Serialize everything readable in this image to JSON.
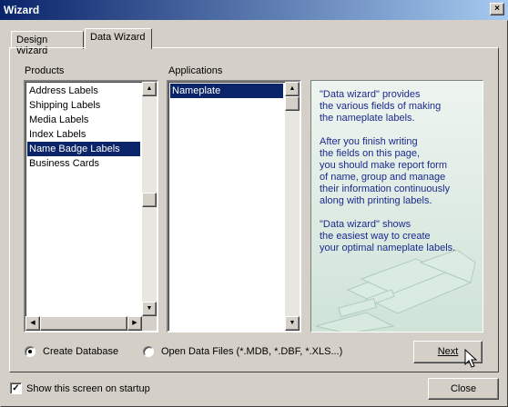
{
  "window": {
    "title": "Wizard",
    "close_glyph": "×"
  },
  "tabs": [
    {
      "label": "Design Wizard"
    },
    {
      "label": "Data Wizard"
    }
  ],
  "products": {
    "label": "Products",
    "items": [
      "Address Labels",
      "Shipping Labels",
      "Media Labels",
      "Index Labels",
      "Name Badge Labels",
      "Business Cards"
    ],
    "selected": "Name Badge Labels"
  },
  "applications": {
    "label": "Applications",
    "items": [
      "Nameplate"
    ],
    "selected": "Nameplate"
  },
  "info": {
    "paragraphs": [
      "\"Data wizard\" provides\nthe various fields of making\nthe nameplate labels.",
      "After you finish writing\nthe fields on this page,\nyou should make report form\nof name, group and manage\ntheir information continuously\nalong with printing labels.",
      "\"Data wizard\" shows\nthe easiest way to create\nyour optimal nameplate labels."
    ]
  },
  "options": {
    "create_database": {
      "label": "Create Database",
      "checked": true
    },
    "open_data_files": {
      "label": "Open Data Files (*.MDB, *.DBF, *.XLS...)",
      "checked": false
    }
  },
  "buttons": {
    "next": "Next",
    "close": "Close"
  },
  "startup": {
    "label": "Show this screen on startup",
    "checked": true,
    "check_glyph": "✓"
  },
  "scroll_glyphs": {
    "up": "▲",
    "down": "▼",
    "left": "◀",
    "right": "▶"
  },
  "colors": {
    "title_start": "#0a246a",
    "title_end": "#a6caf0",
    "selection": "#0a246a",
    "info_text": "#1a2a8c"
  }
}
